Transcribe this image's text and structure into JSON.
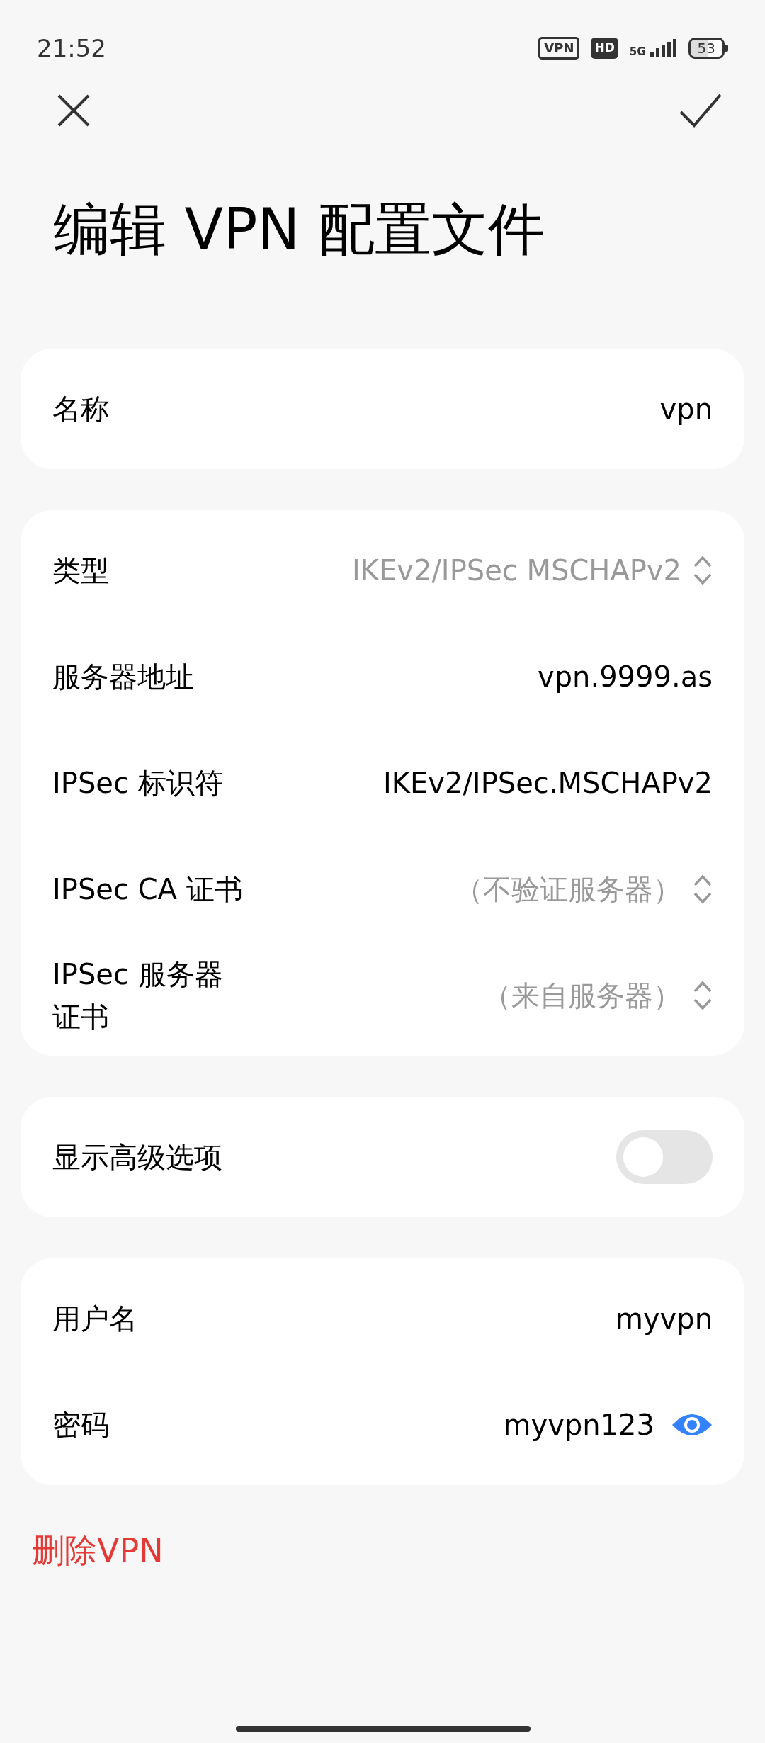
{
  "status_bar": {
    "time": "21:52",
    "vpn_badge": "VPN",
    "hd_badge": "HD",
    "network": "5G",
    "battery": "53"
  },
  "title": "编辑 VPN 配置文件",
  "groups": [
    {
      "rows": [
        {
          "kind": "text",
          "label": "名称",
          "value": "vpn"
        }
      ]
    },
    {
      "rows": [
        {
          "kind": "select",
          "label": "类型",
          "value": "IKEv2/IPSec MSCHAPv2"
        },
        {
          "kind": "text",
          "label": "服务器地址",
          "value": "vpn.9999.as"
        },
        {
          "kind": "text",
          "label": "IPSec 标识符",
          "value": "IKEv2/IPSec.MSCHAPv2"
        },
        {
          "kind": "select",
          "label": "IPSec CA 证书",
          "value": "（不验证服务器）"
        },
        {
          "kind": "select",
          "label": "IPSec 服务器证书",
          "value": "（来自服务器）"
        }
      ]
    },
    {
      "rows": [
        {
          "kind": "toggle",
          "label": "显示高级选项",
          "on": false
        }
      ]
    },
    {
      "rows": [
        {
          "kind": "text",
          "label": "用户名",
          "value": "myvpn"
        },
        {
          "kind": "password",
          "label": "密码",
          "value": "myvpn123"
        }
      ]
    }
  ],
  "delete_button": "删除VPN"
}
